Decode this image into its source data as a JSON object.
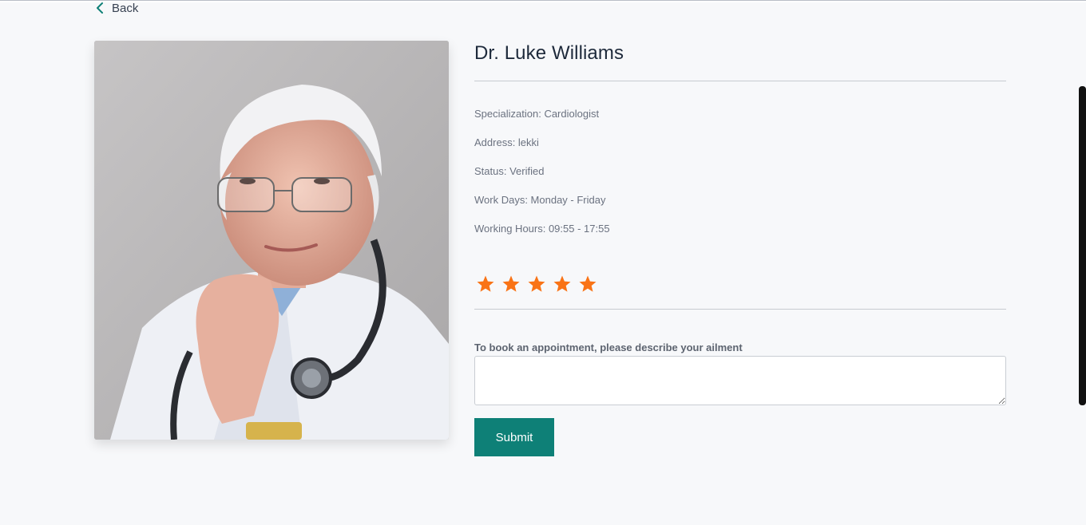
{
  "nav": {
    "back_label": "Back"
  },
  "doctor": {
    "name": "Dr. Luke Williams",
    "specialization": "Specialization: Cardiologist",
    "address": "Address: lekki",
    "status": "Status: Verified",
    "work_days": "Work Days: Monday - Friday",
    "working_hours": "Working Hours: 09:55 - 17:55",
    "rating": 5,
    "rating_max": 5
  },
  "booking": {
    "label": "To book an appointment, please describe your ailment",
    "value": "",
    "placeholder": "",
    "submit_label": "Submit"
  },
  "icons": {
    "back": "chevron-left-icon",
    "star": "star-icon"
  },
  "colors": {
    "accent": "#0e8077",
    "star": "#f97316",
    "background": "#f7f8fa"
  }
}
